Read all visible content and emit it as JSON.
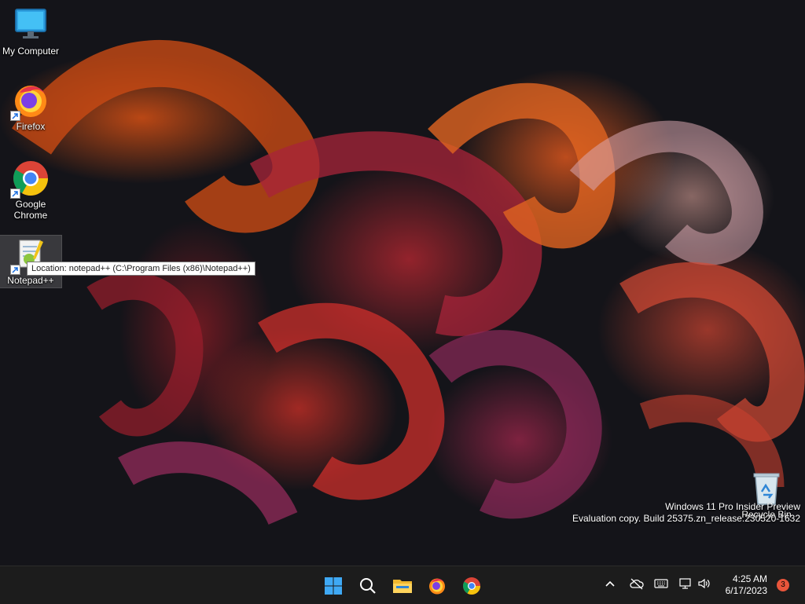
{
  "desktop_icons": {
    "my_computer": {
      "label": "My Computer",
      "icon": "monitor-icon"
    },
    "firefox": {
      "label": "Firefox",
      "icon": "firefox-icon"
    },
    "chrome": {
      "label": "Google Chrome",
      "icon": "chrome-icon"
    },
    "notepadpp": {
      "label": "Notepad++",
      "icon": "notepad-plus-plus-icon"
    },
    "recycle_bin": {
      "label": "Recycle Bin",
      "icon": "recycle-bin-icon"
    }
  },
  "tooltip": {
    "text": "Location: notepad++ (C:\\Program Files (x86)\\Notepad++)"
  },
  "watermark": {
    "line1": "Windows 11 Pro Insider Preview",
    "line2": "Evaluation copy. Build 25375.zn_release.230520-1632"
  },
  "taskbar": {
    "apps": [
      "start-icon",
      "search-icon",
      "file-explorer-icon",
      "firefox-icon",
      "chrome-icon"
    ],
    "clock": {
      "time": "4:25 AM",
      "date": "6/17/2023"
    },
    "notification_count": "3"
  },
  "colors": {
    "accent": "#e8553b",
    "taskbar": "#1c1c1c"
  }
}
